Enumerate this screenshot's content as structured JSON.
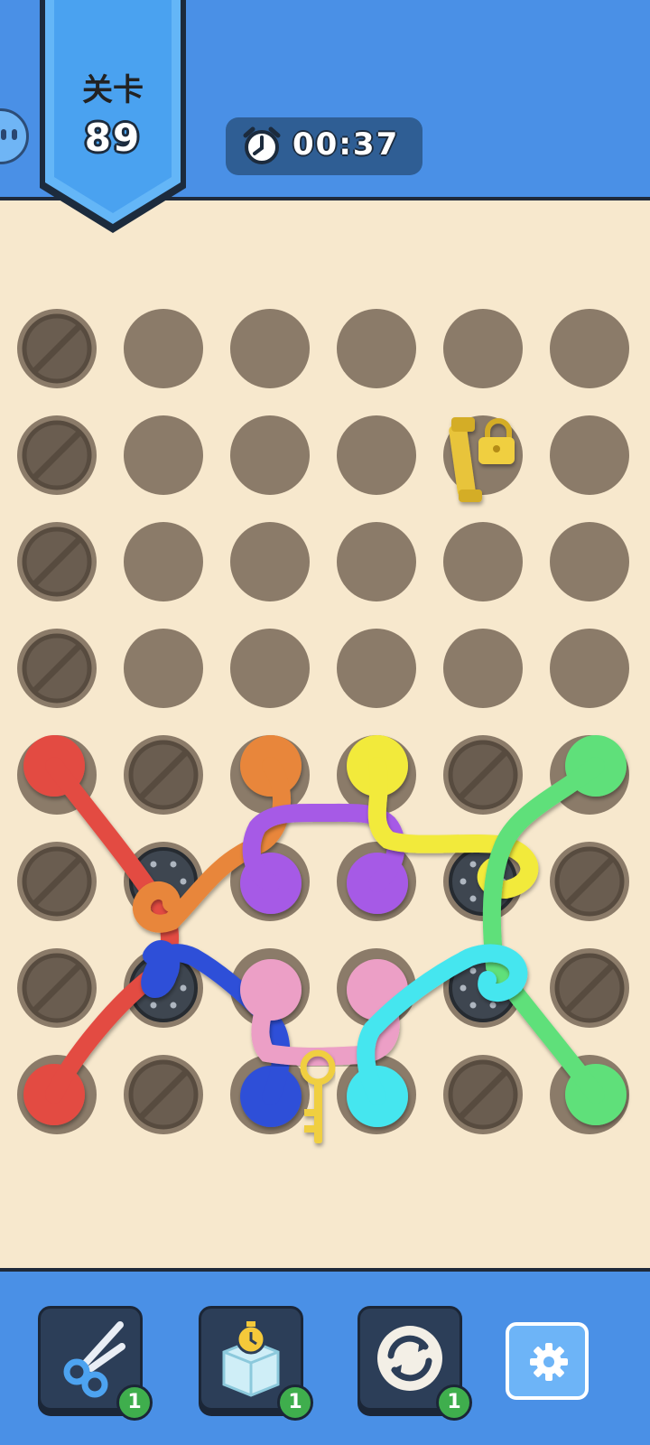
{
  "header": {
    "level_label": "关卡",
    "level_number": "89",
    "timer": "00:37"
  },
  "board": {
    "rows": 8,
    "cols": 6,
    "blocked_holes": [
      [
        0,
        0
      ],
      [
        1,
        0
      ],
      [
        2,
        0
      ],
      [
        3,
        0
      ],
      [
        4,
        1
      ],
      [
        4,
        4
      ],
      [
        5,
        0
      ],
      [
        5,
        5
      ],
      [
        6,
        0
      ],
      [
        6,
        5
      ],
      [
        7,
        1
      ],
      [
        7,
        4
      ]
    ],
    "bolt_holes": [
      [
        5,
        1
      ],
      [
        6,
        1
      ],
      [
        5,
        4
      ],
      [
        6,
        4
      ]
    ],
    "ropes": [
      {
        "color": "#e34b43",
        "name": "red"
      },
      {
        "color": "#e8863a",
        "name": "orange"
      },
      {
        "color": "#2f4fd8",
        "name": "blue"
      },
      {
        "color": "#a65ae6",
        "name": "purple"
      },
      {
        "color": "#ec9fc6",
        "name": "pink"
      },
      {
        "color": "#f2ea3a",
        "name": "yellow"
      },
      {
        "color": "#5ee07a",
        "name": "green"
      },
      {
        "color": "#44e6ef",
        "name": "cyan"
      }
    ],
    "items": [
      "padlock-icon",
      "key-icon"
    ]
  },
  "tools": [
    {
      "icon": "scissors-icon",
      "count": "1"
    },
    {
      "icon": "freeze-timer-icon",
      "count": "1"
    },
    {
      "icon": "shuffle-icon",
      "count": "1"
    },
    {
      "icon": "gear-icon",
      "count": ""
    }
  ],
  "colors": {
    "header_blue": "#4a90e6",
    "board_bg": "#f7e8cd",
    "hole": "#8b7b69"
  }
}
